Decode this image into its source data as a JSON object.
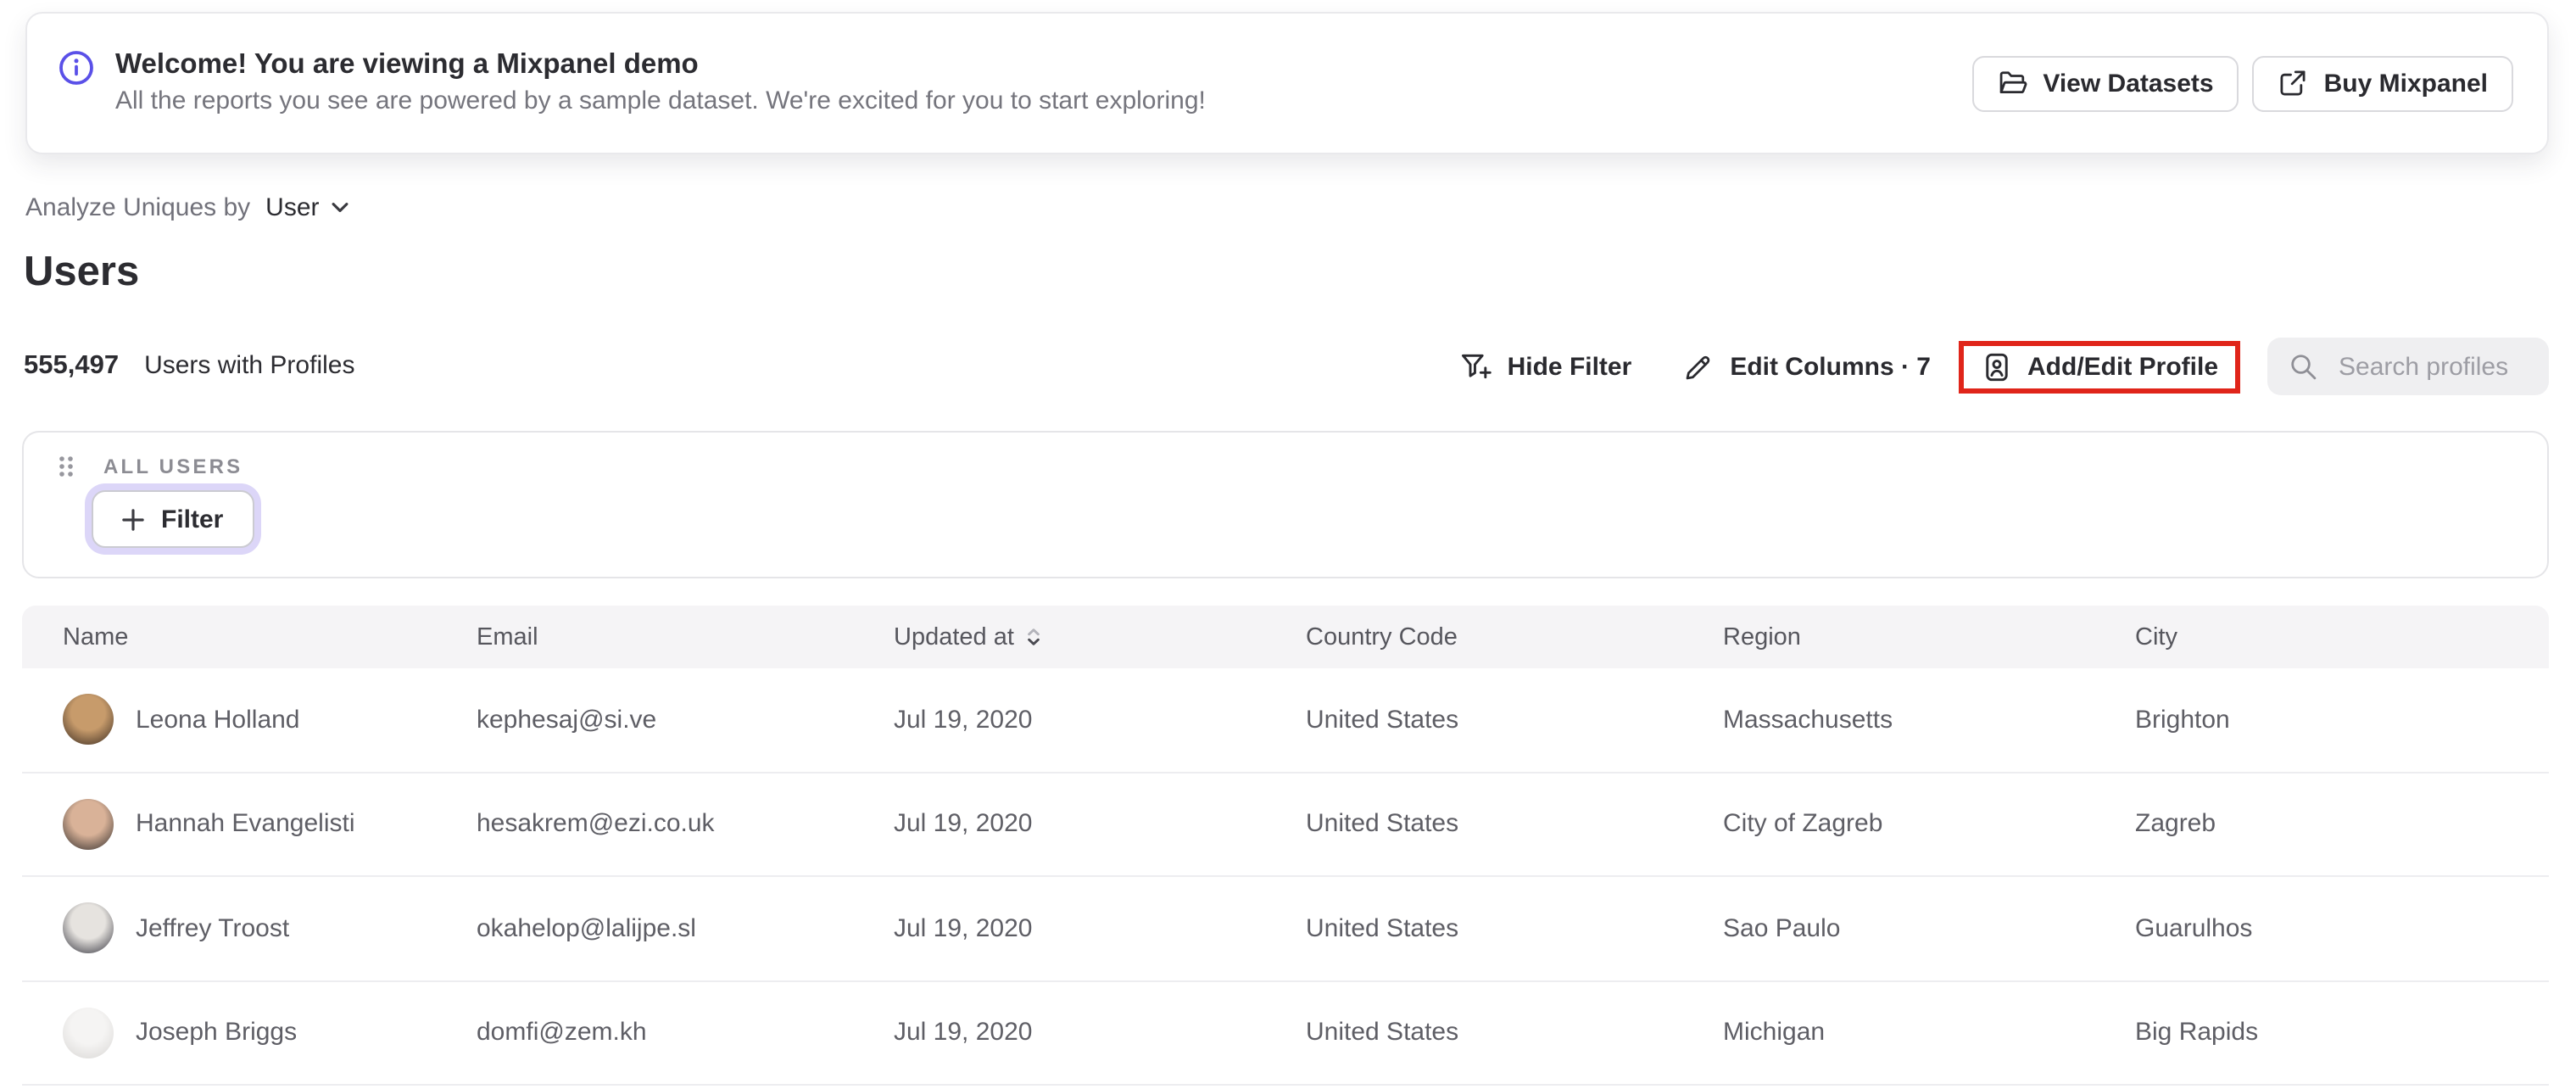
{
  "banner": {
    "title": "Welcome! You are viewing a Mixpanel demo",
    "subtitle": "All the reports you see are powered by a sample dataset. We're excited for you to start exploring!",
    "buttons": [
      {
        "label": "View Datasets",
        "icon": "folder-icon"
      },
      {
        "label": "Buy Mixpanel",
        "icon": "external-link-icon"
      }
    ]
  },
  "analyze_bar": {
    "prefix": "Analyze Uniques by",
    "selected": "User"
  },
  "page_title": "Users",
  "stats": {
    "count": "555,497",
    "label": "Users with Profiles"
  },
  "toolbar": {
    "hide_filter_label": "Hide Filter",
    "edit_columns_label": "Edit Columns · 7",
    "add_edit_profile_label": "Add/Edit Profile",
    "search_placeholder": "Search profiles"
  },
  "filter_panel": {
    "group_label": "ALL USERS",
    "filter_button_label": "Filter"
  },
  "table": {
    "columns": [
      "Name",
      "Email",
      "Updated at",
      "Country Code",
      "Region",
      "City"
    ],
    "rows": [
      {
        "name": "Leona Holland",
        "email": "kephesaj@si.ve",
        "updated_at": "Jul 19, 2020",
        "country": "United States",
        "region": "Massachusetts",
        "city": "Brighton",
        "avatar": {
          "c1": "#c79b6b",
          "c2": "#37291f"
        }
      },
      {
        "name": "Hannah Evangelisti",
        "email": "hesakrem@ezi.co.uk",
        "updated_at": "Jul 19, 2020",
        "country": "United States",
        "region": "City of Zagreb",
        "city": "Zagreb",
        "avatar": {
          "c1": "#d9b298",
          "c2": "#2e2a29"
        }
      },
      {
        "name": "Jeffrey Troost",
        "email": "okahelop@lalijpe.sl",
        "updated_at": "Jul 19, 2020",
        "country": "United States",
        "region": "Sao Paulo",
        "city": "Guarulhos",
        "avatar": {
          "c1": "#e6e3df",
          "c2": "#30303a"
        }
      },
      {
        "name": "Joseph Briggs",
        "email": "domfi@zem.kh",
        "updated_at": "Jul 19, 2020",
        "country": "United States",
        "region": "Michigan",
        "city": "Big Rapids",
        "avatar": {
          "c1": "#f5f4f3",
          "c2": "#d8d6d4"
        }
      }
    ]
  },
  "colors": {
    "accent_purple": "#5a50e8",
    "annotation_red": "#e0251a",
    "focus_ring_lavender": "#dcd6f8",
    "header_bg": "#f5f4f6"
  },
  "icons": [
    "info-icon",
    "folder-icon",
    "external-link-icon",
    "chevron-down-icon",
    "funnel-plus-icon",
    "pencil-icon",
    "id-badge-icon",
    "search-icon",
    "drag-handle-icon",
    "plus-icon",
    "sort-icon"
  ]
}
